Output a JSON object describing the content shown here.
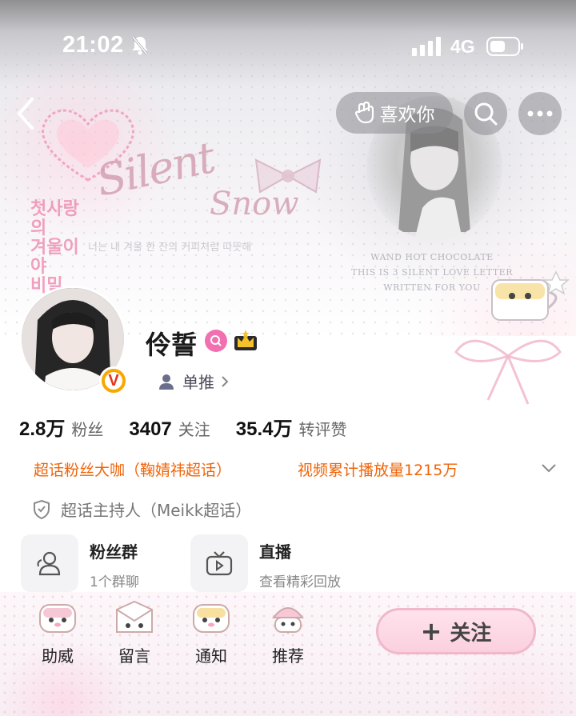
{
  "status_bar": {
    "time": "21:02",
    "network": "4G"
  },
  "nav": {
    "like_label": "喜欢你"
  },
  "profile": {
    "name": "伶誓",
    "fan_link_label": "单推",
    "stats": [
      {
        "value": "2.8万",
        "label": "粉丝"
      },
      {
        "value": "3407",
        "label": "关注"
      },
      {
        "value": "35.4万",
        "label": "转评赞"
      }
    ],
    "achievements": [
      "超话粉丝大咖（鞠婧祎超话）",
      "视频累计播放量1215万"
    ],
    "host_label": "超话主持人（Meikk超话）"
  },
  "features": [
    {
      "title": "粉丝群",
      "subtitle": "1个群聊"
    },
    {
      "title": "直播",
      "subtitle": "查看精彩回放"
    }
  ],
  "bottom_tabs": [
    {
      "label": "助威"
    },
    {
      "label": "留言"
    },
    {
      "label": "通知"
    },
    {
      "label": "推荐"
    }
  ],
  "follow_label": "关注",
  "colors": {
    "accent_orange": "#f0640a",
    "follow_pink": "#fbd0de",
    "verified_gold": "#f8a800"
  }
}
